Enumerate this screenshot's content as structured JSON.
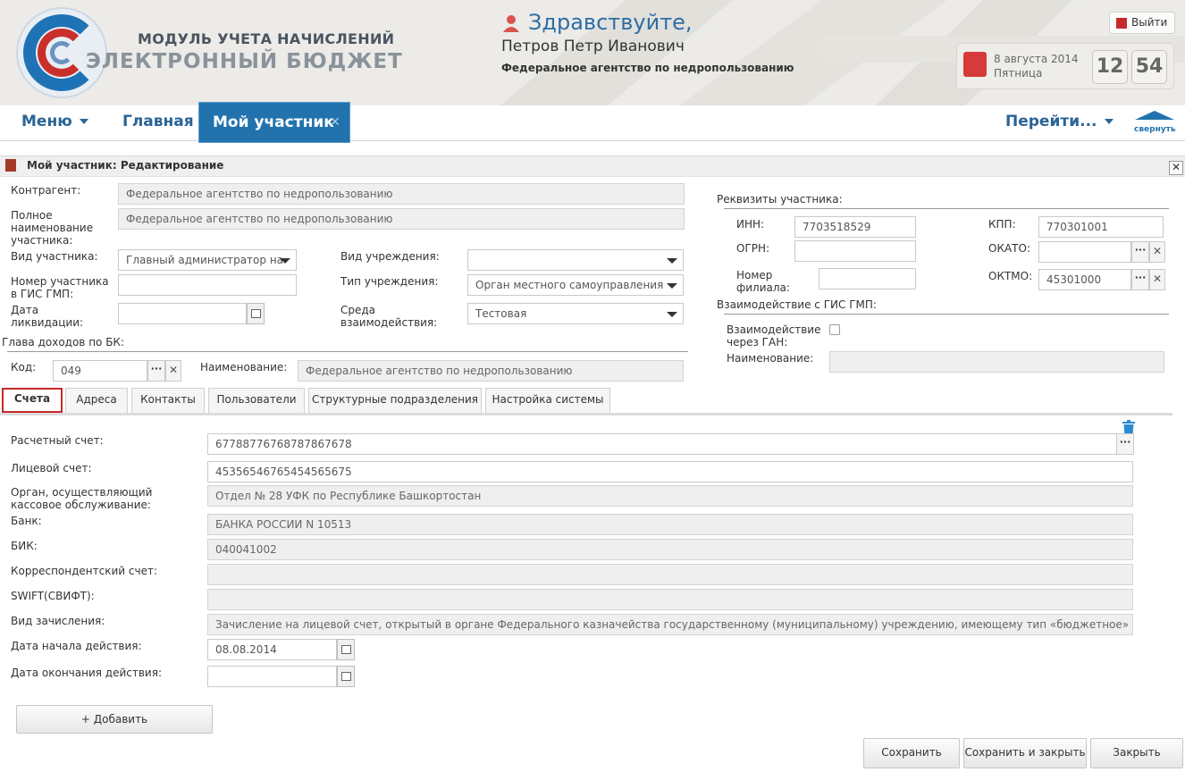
{
  "header": {
    "logo_line1": "МОДУЛЬ УЧЕТА НАЧИСЛЕНИЙ",
    "logo_line2": "ЭЛЕКТРОННЫЙ БЮДЖЕТ",
    "greeting": "Здравствуйте,",
    "user_name": "Петров Петр Иванович",
    "organization": "Федеральное агентство по недропользованию",
    "logout_label": "Выйти",
    "date": "8 августа 2014",
    "weekday": "Пятница",
    "clock_hours": "12",
    "clock_minutes": "54"
  },
  "nav": {
    "menu_label": "Меню",
    "home_label": "Главная",
    "active_tab_label": "Мой участник",
    "goto_label": "Перейти...",
    "collapse_label": "свернуть"
  },
  "panel": {
    "title": "Мой участник: Редактирование"
  },
  "participant": {
    "counterparty_label": "Контрагент:",
    "counterparty_value": "Федеральное агентство по недропользованию",
    "full_name_label": "Полное наименование участника:",
    "full_name_value": "Федеральное агентство по недропользованию",
    "type_label": "Вид участника:",
    "type_value": "Главный администратор на",
    "gis_number_label": "Номер участника в ГИС ГМП:",
    "gis_number_value": "",
    "liquidation_label": "Дата ликвидации:",
    "liquidation_value": "",
    "institution_kind_label": "Вид учреждения:",
    "institution_kind_value": "",
    "institution_type_label": "Тип учреждения:",
    "institution_type_value": "Орган местного самоуправления",
    "environment_label": "Среда взаимодействия:",
    "environment_value": "Тестовая",
    "bk_section_label": "Глава доходов по БК:",
    "code_label": "Код:",
    "code_value": "049",
    "name_label": "Наименование:",
    "name_value": "Федеральное агентство по недропользованию"
  },
  "requisites": {
    "section_label": "Реквизиты участника:",
    "inn_label": "ИНН:",
    "inn_value": "7703518529",
    "ogrn_label": "ОГРН:",
    "ogrn_value": "",
    "branch_label": "Номер филиала:",
    "branch_value": "",
    "kpp_label": "КПП:",
    "kpp_value": "770301001",
    "okato_label": "ОКАТО:",
    "okato_value": "",
    "oktmo_label": "ОКТМО:",
    "oktmo_value": "45301000",
    "gis_section_label": "Взаимодействие с ГИС ГМП:",
    "gan_label": "Взаимодействие через ГАН:",
    "gan_name_label": "Наименование:",
    "gan_name_value": ""
  },
  "tabs": [
    {
      "label": "Счета"
    },
    {
      "label": "Адреса"
    },
    {
      "label": "Контакты"
    },
    {
      "label": "Пользователи"
    },
    {
      "label": "Структурные подразделения"
    },
    {
      "label": "Настройка системы"
    }
  ],
  "account": {
    "settlement_label": "Расчетный счет:",
    "settlement_value": "67788776768787867678",
    "personal_label": "Лицевой счет:",
    "personal_value": "45356546765454565675",
    "cash_org_label": "Орган, осуществляющий кассовое обслуживание:",
    "cash_org_value": "Отдел № 28 УФК по Республике Башкортостан",
    "bank_label": "Банк:",
    "bank_value": "БАНКА РОССИИ N 10513",
    "bik_label": "БИК:",
    "bik_value": "040041002",
    "corr_label": "Корреспондентский счет:",
    "corr_value": "",
    "swift_label": "SWIFT(СВИФТ):",
    "swift_value": "",
    "enroll_label": "Вид зачисления:",
    "enroll_value": "Зачисление на лицевой счет, открытый в органе Федерального казначейства государственному (муниципальному) учреждению, имеющему тип «бюджетное» или «автономное»",
    "start_label": "Дата начала действия:",
    "start_value": "08.08.2014",
    "end_label": "Дата окончания действия:",
    "end_value": ""
  },
  "buttons": {
    "add": "+ Добавить",
    "save": "Сохранить",
    "save_close": "Сохранить и закрыть",
    "close": "Закрыть"
  },
  "colors": {
    "accent": "#2273ad",
    "nav_text": "#2a6496",
    "highlight": "#c62a2a"
  }
}
